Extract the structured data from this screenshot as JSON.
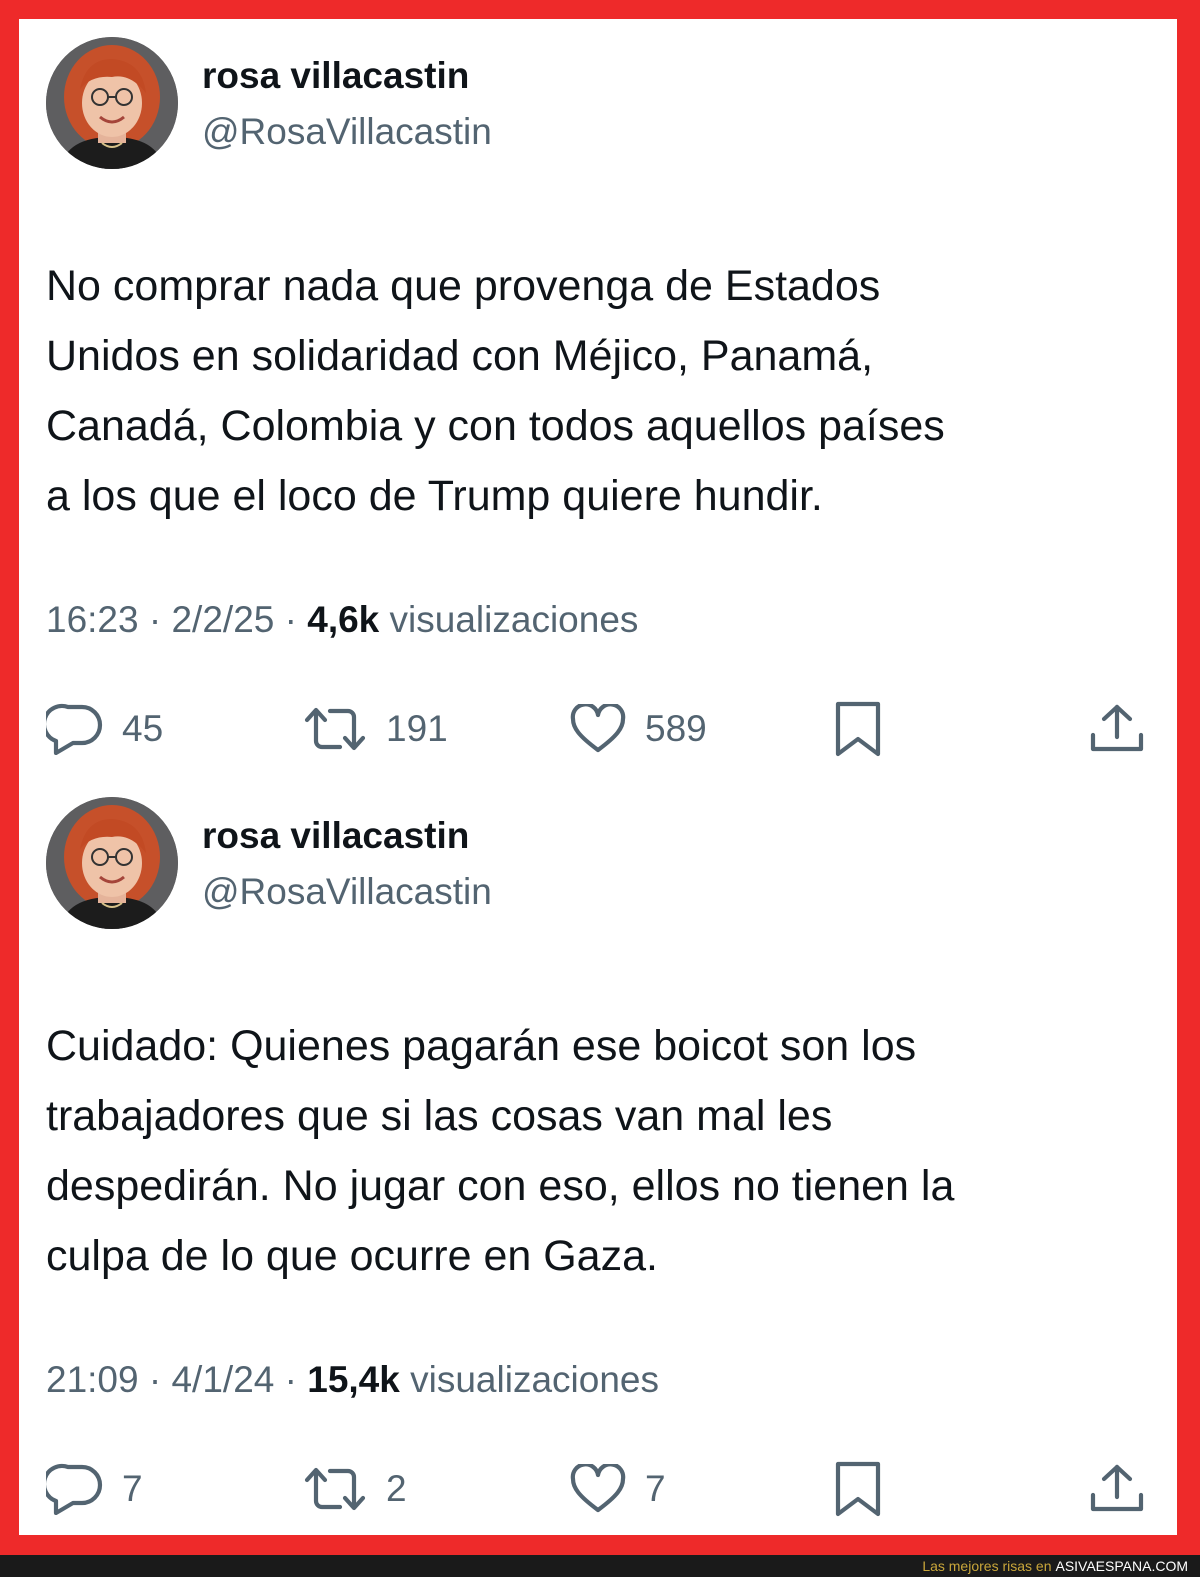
{
  "tweets": [
    {
      "author_name": "rosa villacastin",
      "handle": "@RosaVillacastin",
      "text": "No comprar nada que provenga de Estados\nUnidos en solidaridad con Méjico, Panamá,\nCanadá, Colombia y con todos  aquellos países\na los que el loco de Trump quiere hundir.",
      "time": "16:23",
      "date": "2/2/25",
      "views": "4,6k",
      "views_label": "visualizaciones",
      "replies": "45",
      "retweets": "191",
      "likes": "589"
    },
    {
      "author_name": "rosa villacastin",
      "handle": "@RosaVillacastin",
      "text": "Cuidado: Quienes pagarán ese boicot son los\ntrabajadores que si las cosas van mal les\ndespedirán. No jugar con eso, ellos no tienen la\nculpa de lo que ocurre en Gaza.",
      "time": "21:09",
      "date": "4/1/24",
      "views": "15,4k",
      "views_label": "visualizaciones",
      "replies": "7",
      "retweets": "2",
      "likes": "7"
    }
  ],
  "meta_separator": " · ",
  "icons": [
    "reply-icon",
    "retweet-icon",
    "like-icon",
    "bookmark-icon",
    "share-icon"
  ],
  "footer": {
    "prefix": "Las mejores risas en",
    "site": "ASIVAESPANA.COM"
  },
  "colors": {
    "frame": "#ee2a2a",
    "text_primary": "#0f1419",
    "text_secondary": "#536471",
    "footer_bg": "#1a1a1a",
    "footer_prefix": "#c9a63a"
  }
}
